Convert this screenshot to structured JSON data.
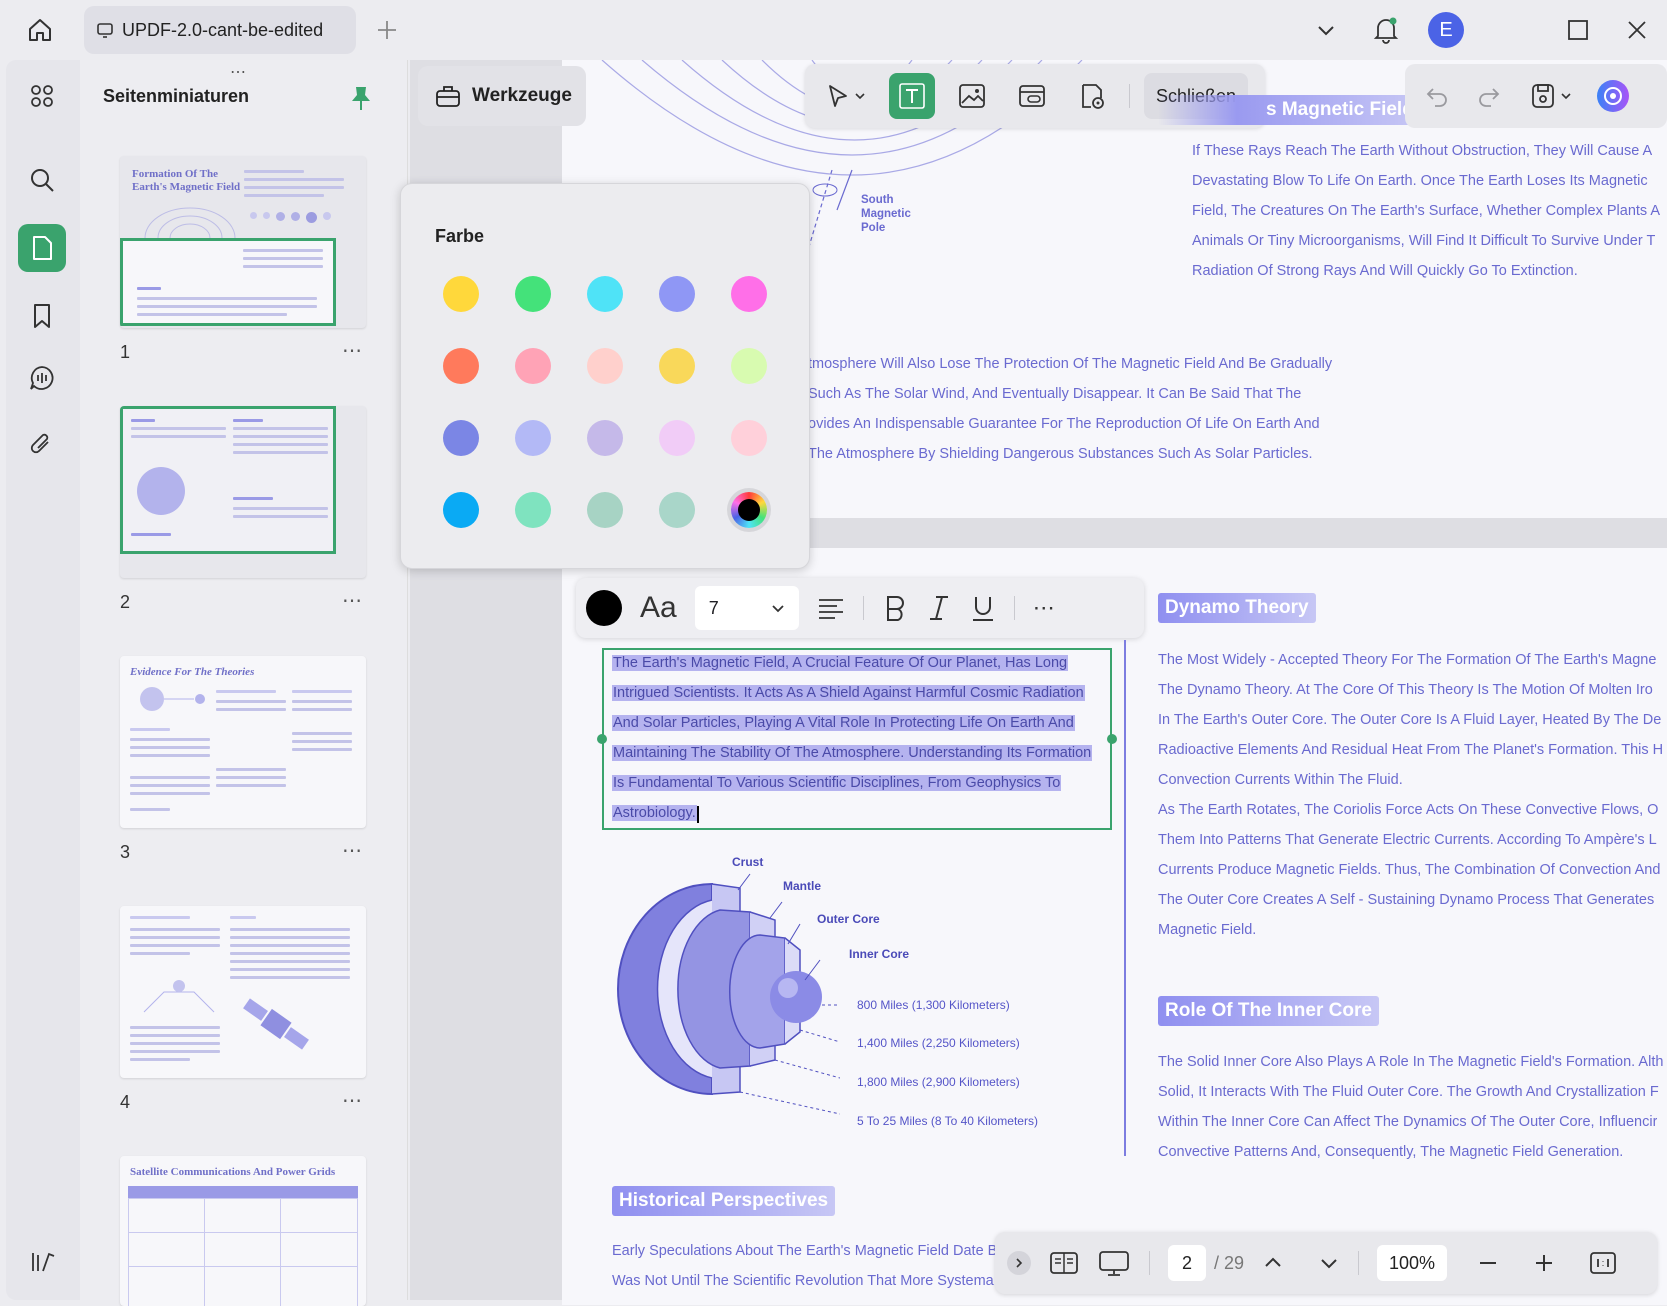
{
  "titlebar": {
    "tab_title": "UPDF-2.0-cant-be-edited",
    "avatar_initial": "E"
  },
  "sidebar": {
    "title": "Seitenminiaturen",
    "pages": [
      {
        "num": "1",
        "heading": "Formation Of The Earth's Magnetic Field"
      },
      {
        "num": "2",
        "heading": ""
      },
      {
        "num": "3",
        "heading": "Evidence For The Theories"
      },
      {
        "num": "4",
        "heading": ""
      },
      {
        "num": "",
        "heading": "Satellite Communications And Power Grids"
      }
    ]
  },
  "tools": {
    "werkzeuge_label": "Werkzeuge",
    "close_label": "Schließen"
  },
  "colorpicker": {
    "title": "Farbe",
    "colors": [
      "#ffd83b",
      "#44e27a",
      "#4fe3f7",
      "#8f97f5",
      "#ff6fe8",
      "#ff7a5c",
      "#ffa3b6",
      "#ffd0cc",
      "#f9d85a",
      "#d8fbb0",
      "#7b86e5",
      "#b3b9f6",
      "#c5b9e9",
      "#f1ccf7",
      "#ffd0da",
      "#0aaaf4",
      "#7fe3bf",
      "#a7d3c4",
      "#a9d6c9",
      "#000000"
    ]
  },
  "document": {
    "top_heading_partial": "s Magnetic Field",
    "south_label": "South\nMagnetic\nPole",
    "top_right_lines": [
      "If These Rays Reach The Earth Without Obstruction, They Will Cause A",
      "Devastating Blow To Life On Earth. Once The Earth Loses Its Magnetic",
      "Field, The Creatures On The Earth's Surface, Whether Complex Plants A",
      "Animals Or Tiny Microorganisms, Will Find It Difficult To Survive Under T",
      "Radiation Of Strong Rays And Will Quickly Go To Extinction."
    ],
    "mid_lines": [
      "tmosphere Will Also Lose The Protection Of The Magnetic Field And Be Gradually",
      "Such As The Solar Wind, And Eventually Disappear. It Can Be Said That The",
      "ovides An Indispensable Guarantee For The Reproduction Of Life On Earth And",
      "The Atmosphere By Shielding Dangerous Substances Such As Solar Particles."
    ],
    "selected_lines": [
      "The Earth's Magnetic Field, A Crucial Feature Of Our Planet, Has Long",
      "Intrigued Scientists. It Acts As A Shield Against Harmful Cosmic Radiation",
      "And Solar Particles, Playing A Vital Role In Protecting Life On Earth And",
      "Maintaining The Stability Of The Atmosphere. Understanding Its Formation",
      "Is Fundamental To Various Scientific Disciplines, From Geophysics To",
      "Astrobiology."
    ],
    "diagram_labels": {
      "crust": "Crust",
      "mantle": "Mantle",
      "outer_core": "Outer Core",
      "inner_core": "Inner Core",
      "d1": "800 Miles (1,300 Kilometers)",
      "d2": "1,400 Miles (2,250 Kilometers)",
      "d3": "1,800 Miles (2,900 Kilometers)",
      "d4": "5 To 25 Miles (8 To 40 Kilometers)"
    },
    "dynamo_heading": "Dynamo Theory",
    "dynamo_lines": [
      "The Most Widely - Accepted Theory For The Formation Of The Earth's Magne",
      "The Dynamo Theory. At The Core Of This Theory Is The Motion Of Molten Iro",
      "In The Earth's Outer Core. The Outer Core Is A Fluid Layer, Heated By The De",
      "Radioactive Elements And Residual Heat From The Planet's Formation. This H",
      "Convection Currents Within The Fluid.",
      "As The Earth Rotates, The Coriolis Force Acts On These Convective Flows, O",
      "Them Into Patterns That Generate Electric Currents. According To Ampère's L",
      "Currents Produce Magnetic Fields. Thus, The Combination Of Convection And",
      "The Outer Core Creates A Self - Sustaining Dynamo Process That Generates",
      "Magnetic Field."
    ],
    "inner_core_heading": "Role Of The Inner Core",
    "inner_core_lines": [
      "The Solid Inner Core Also Plays A Role In The Magnetic Field's Formation. Alth",
      "Solid, It Interacts With The Fluid Outer Core. The Growth And Crystallization F",
      "Within The Inner Core Can Affect The Dynamics Of The Outer Core, Influencir",
      "Convective Patterns And, Consequently, The Magnetic Field Generation."
    ],
    "historical_heading": "Historical Perspectives",
    "historical_lines": [
      "Early Speculations About The Earth's Magnetic Field Date B",
      "Was Not Until The Scientific Revolution That More Systema"
    ]
  },
  "format_bar": {
    "font_icon": "Aa",
    "font_size": "7"
  },
  "bottom_bar": {
    "current_page": "2",
    "total_pages": "/ 29",
    "zoom": "100%"
  }
}
